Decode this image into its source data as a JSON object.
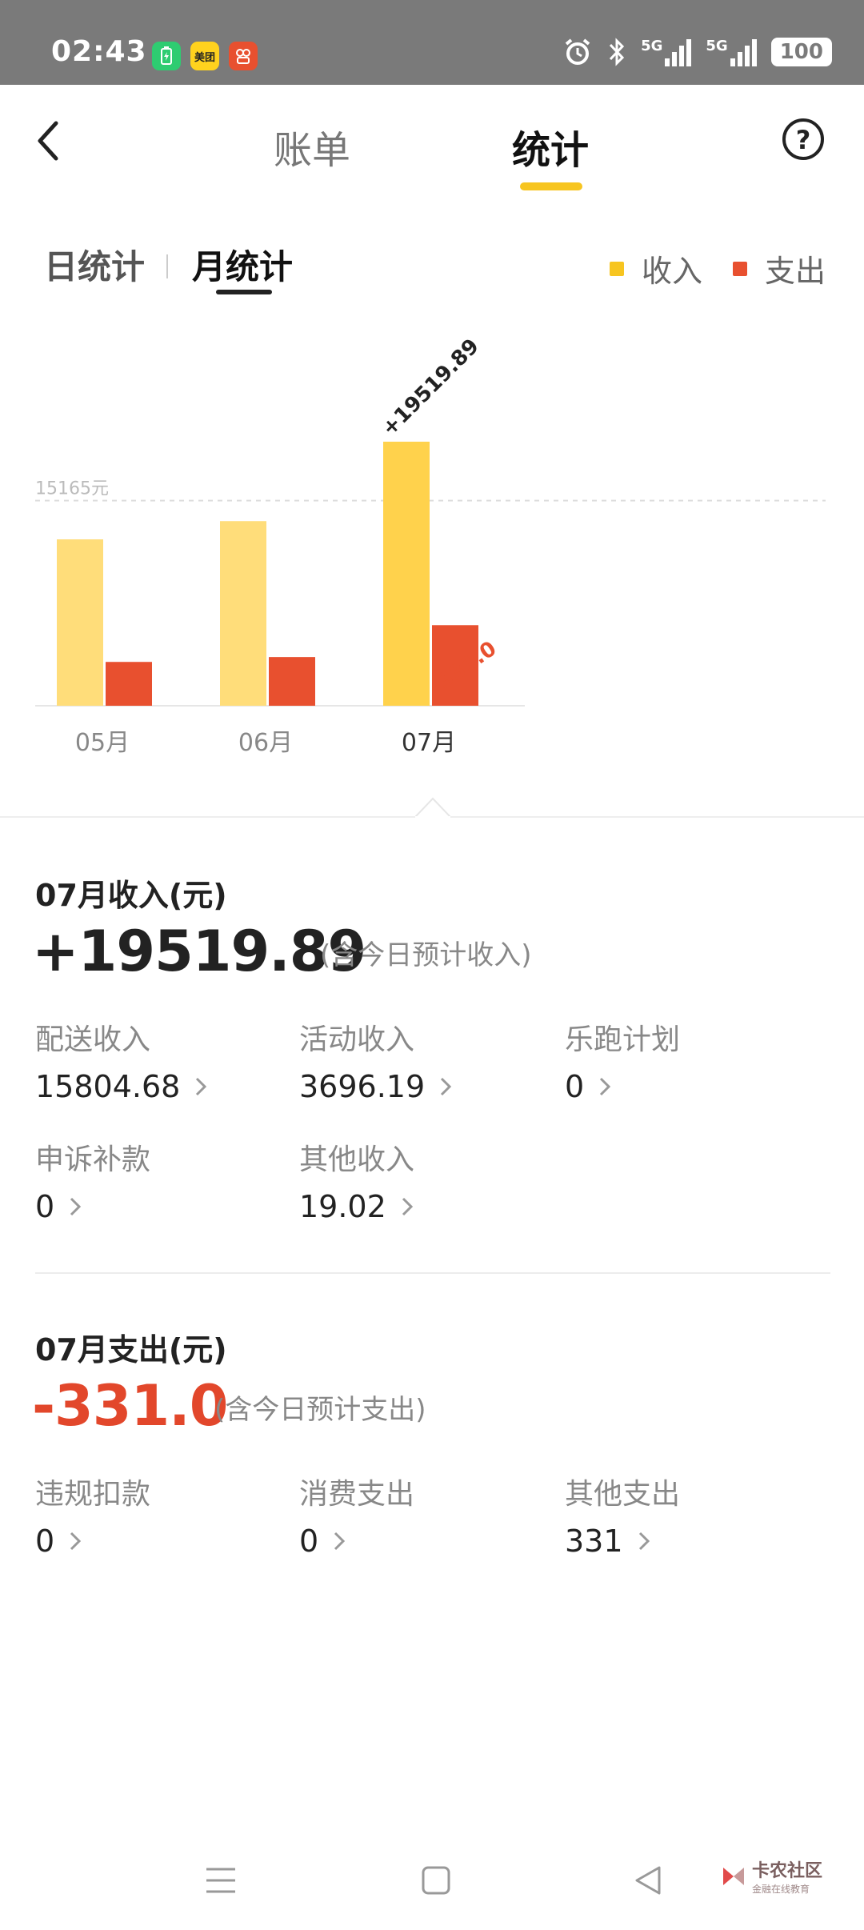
{
  "status_bar": {
    "time": "02:43",
    "badges": [
      "",
      "美团",
      ""
    ],
    "network1": "5G",
    "network2": "5G",
    "battery": "100"
  },
  "header": {
    "tab_bill": "账单",
    "tab_stats": "统计",
    "help": "?"
  },
  "subtabs": {
    "day": "日统计",
    "month": "月统计"
  },
  "legend": {
    "income": "收入",
    "expense": "支出"
  },
  "colors": {
    "income": "#ffdd7a",
    "income_active": "#ffd24c",
    "expense": "#e8502f",
    "accent": "#f7c520"
  },
  "chart_data": {
    "type": "bar",
    "categories": [
      "05月",
      "06月",
      "07月"
    ],
    "series": [
      {
        "name": "收入",
        "values": [
          12300,
          13650,
          19519.89
        ]
      },
      {
        "name": "支出",
        "values": [
          180,
          200,
          331.0
        ]
      }
    ],
    "reference_label": "15165元",
    "reference_value": 15165,
    "data_labels": {
      "income": "+19519.89",
      "expense": "-331.0"
    },
    "ylim": [
      0,
      20000
    ],
    "grid": false,
    "legend": "top-right"
  },
  "income_section": {
    "title": "07月收入(元)",
    "amount": "+19519.89",
    "note": "(含今日预计收入)",
    "items": [
      {
        "label": "配送收入",
        "value": "15804.68"
      },
      {
        "label": "活动收入",
        "value": "3696.19"
      },
      {
        "label": "乐跑计划",
        "value": "0"
      },
      {
        "label": "申诉补款",
        "value": "0"
      },
      {
        "label": "其他收入",
        "value": "19.02"
      }
    ]
  },
  "expense_section": {
    "title": "07月支出(元)",
    "amount": "-331.0",
    "note": "(含今日预计支出)",
    "items": [
      {
        "label": "违规扣款",
        "value": "0"
      },
      {
        "label": "消费支出",
        "value": "0"
      },
      {
        "label": "其他支出",
        "value": "331"
      }
    ]
  },
  "watermark": {
    "main": "卡农社区",
    "sub": "金融在线教育"
  }
}
